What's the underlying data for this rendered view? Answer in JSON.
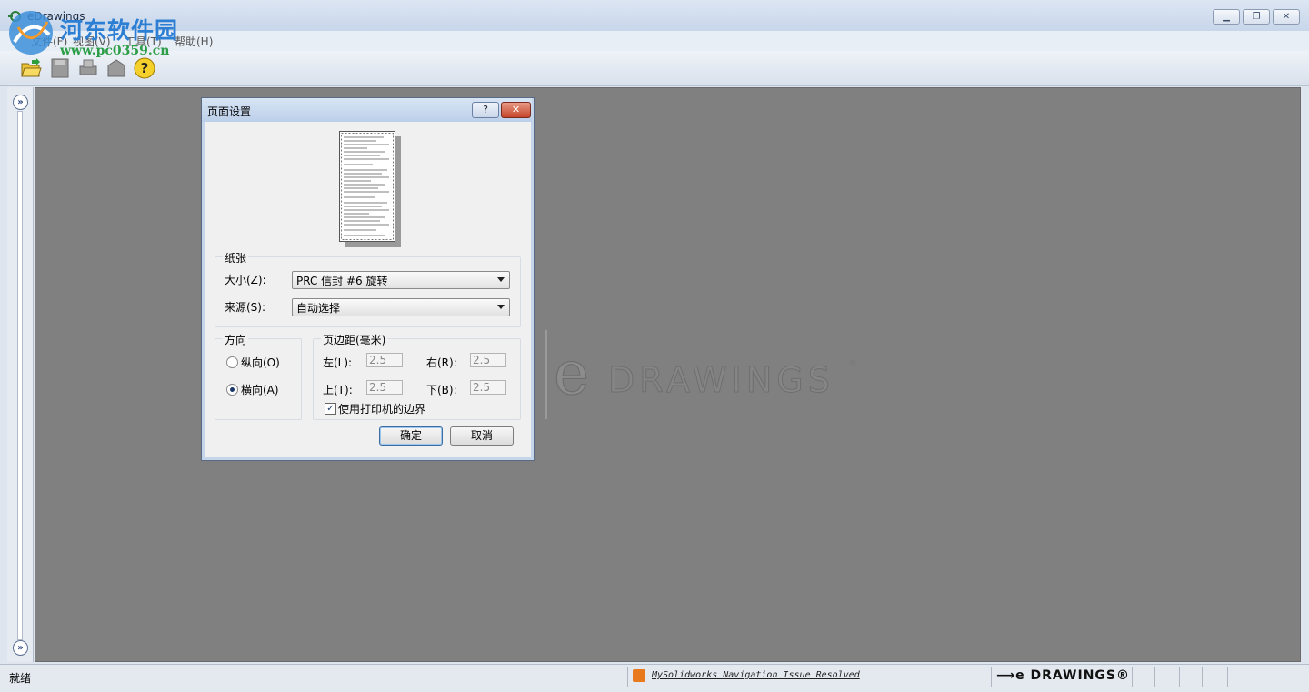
{
  "window": {
    "title": "eDrawings"
  },
  "watermark": {
    "site_name": "河东软件园",
    "site_url": "www.pc0359.cn"
  },
  "menu": [
    "文件(F)",
    "视图(V)",
    "工具(T)",
    "帮助(H)"
  ],
  "toolbar": {
    "icons": [
      "open-folder-icon",
      "save-icon",
      "print-icon",
      "send-mail-icon",
      "help-icon"
    ]
  },
  "canvas": {
    "logo_text": "DRAWINGS",
    "logo_e": "e",
    "logo_reg": "®"
  },
  "statusbar": {
    "status": "就绪",
    "news_link": "MySolidworks Navigation Issue Resolved",
    "brand": "DRAWINGS®",
    "brand_arrow": "⟶e"
  },
  "dialog": {
    "title": "页面设置",
    "help_label": "?",
    "close_label": "✕",
    "paper": {
      "group_label": "纸张",
      "size_label": "大小(Z):",
      "size_value": "PRC 信封 #6 旋转",
      "source_label": "来源(S):",
      "source_value": "自动选择"
    },
    "orientation": {
      "group_label": "方向",
      "portrait_label": "纵向(O)",
      "landscape_label": "横向(A)",
      "selected": "landscape"
    },
    "margins": {
      "group_label": "页边距(毫米)",
      "left_label": "左(L):",
      "left_value": "2.5",
      "right_label": "右(R):",
      "right_value": "2.5",
      "top_label": "上(T):",
      "top_value": "2.5",
      "bottom_label": "下(B):",
      "bottom_value": "2.5",
      "use_printer_label": "使用打印机的边界",
      "use_printer_checked": true
    },
    "ok_label": "确定",
    "cancel_label": "取消"
  }
}
